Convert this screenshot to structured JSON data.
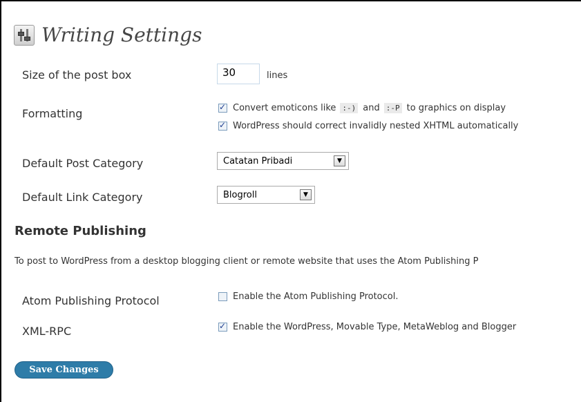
{
  "page": {
    "title": "Writing Settings"
  },
  "post_box": {
    "label": "Size of the post box",
    "value": "30",
    "unit": "lines"
  },
  "formatting": {
    "label": "Formatting",
    "emoticons": {
      "checked": true,
      "text_before": "Convert emoticons like",
      "code1": ":-)",
      "text_mid": "and",
      "code2": ":-P",
      "text_after": "to graphics on display"
    },
    "xhtml": {
      "checked": true,
      "text": "WordPress should correct invalidly nested XHTML automatically"
    }
  },
  "default_post_category": {
    "label": "Default Post Category",
    "selected": "Catatan Pribadi"
  },
  "default_link_category": {
    "label": "Default Link Category",
    "selected": "Blogroll"
  },
  "remote_publishing": {
    "title": "Remote Publishing",
    "description": "To post to WordPress from a desktop blogging client or remote website that uses the Atom Publishing P"
  },
  "atom": {
    "label": "Atom Publishing Protocol",
    "checked": false,
    "text": "Enable the Atom Publishing Protocol."
  },
  "xmlrpc": {
    "label": "XML-RPC",
    "checked": true,
    "text": "Enable the WordPress, Movable Type, MetaWeblog and Blogger"
  },
  "save_button": {
    "label": "Save Changes"
  }
}
